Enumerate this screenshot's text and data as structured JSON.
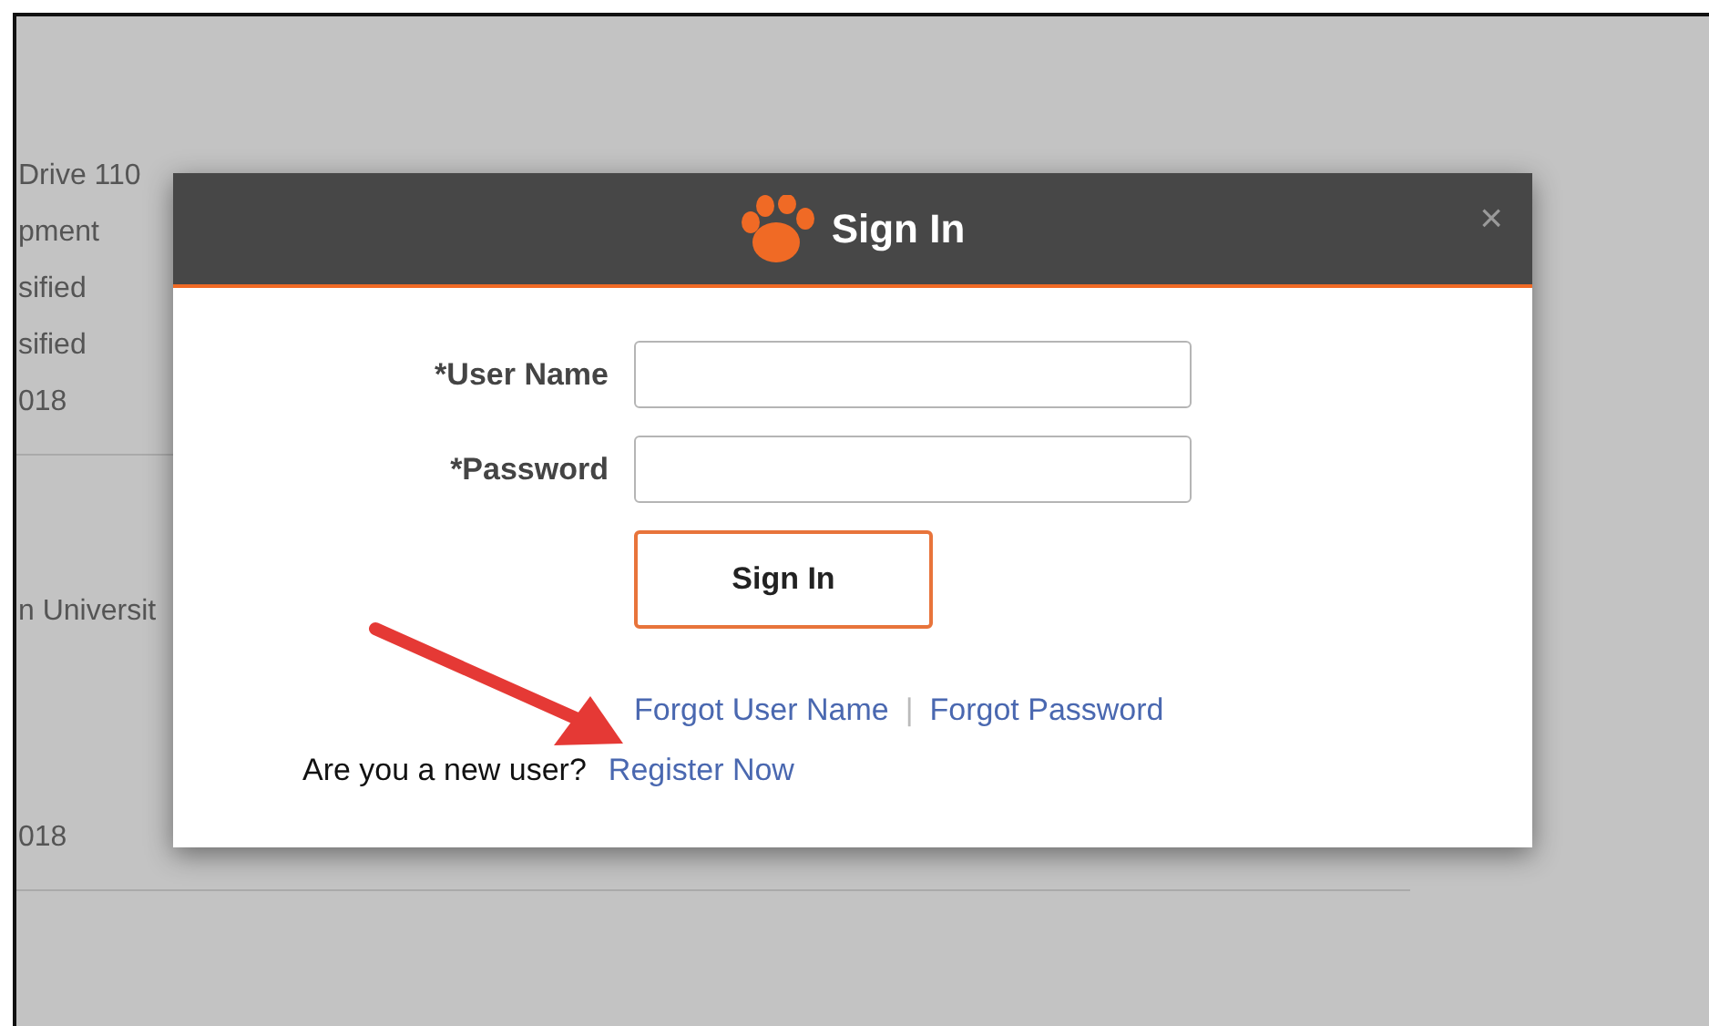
{
  "background": {
    "groups": [
      {
        "lines": [
          "Drive 110",
          "pment",
          "sified",
          "sified",
          "018"
        ],
        "divider": true
      },
      {
        "lines": [
          "n Universit"
        ],
        "divider": false
      },
      {
        "lines": [
          "018"
        ],
        "divider": true
      }
    ]
  },
  "dialog": {
    "title": "Sign In",
    "close": "×",
    "fields": [
      {
        "label": "*User Name"
      },
      {
        "label": "*Password"
      }
    ],
    "submit": "Sign In",
    "links": [
      "Forgot User Name",
      "Forgot Password"
    ],
    "separator": "|",
    "register_prompt": "Are you a new user?",
    "register_link": "Register Now"
  }
}
